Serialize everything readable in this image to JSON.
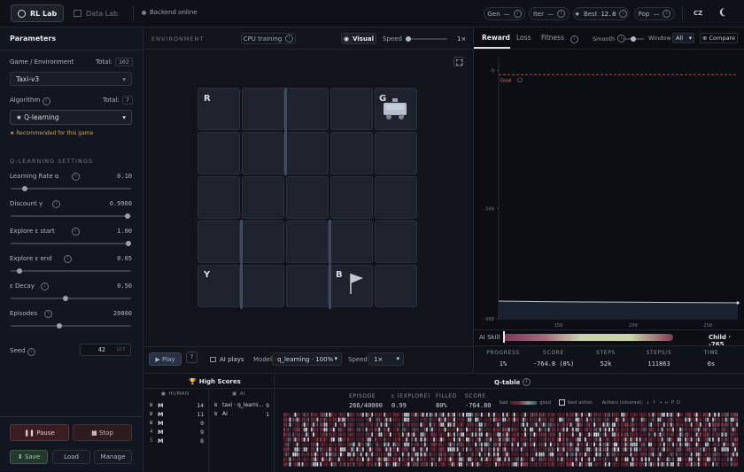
{
  "topbar": {
    "tabs": [
      {
        "label": "RL Lab"
      },
      {
        "label": "Data Lab"
      }
    ],
    "status": "Backend online",
    "stats": [
      {
        "label": "Gen",
        "value": "—"
      },
      {
        "label": "Iter",
        "value": "—"
      },
      {
        "label": "Best",
        "value": "12.8"
      },
      {
        "label": "Pop",
        "value": "—"
      }
    ],
    "lang": "CZ"
  },
  "sidebar": {
    "title": "Parameters",
    "env": {
      "label": "Game / Environment",
      "total_label": "Total:",
      "total": "102",
      "value": "Taxi-v3"
    },
    "algo": {
      "label": "Algorithm",
      "total_label": "Total:",
      "total": "7",
      "value": "★ Q-learning",
      "note": "★ Recommended for this game"
    },
    "section": "Q-LEARNING SETTINGS",
    "params": [
      {
        "label": "Learning Rate α",
        "value": "0.10",
        "fraction": 0.1
      },
      {
        "label": "Discount γ",
        "value": "0.9900",
        "fraction": 0.99
      },
      {
        "label": "Explore ε start",
        "value": "1.00",
        "fraction": 1.0
      },
      {
        "label": "Explore ε end",
        "value": "0.05",
        "fraction": 0.05
      },
      {
        "label": "ε Decay",
        "value": "0.50",
        "fraction": 0.45
      },
      {
        "label": "Episodes",
        "value": "20000",
        "fraction": 0.4
      }
    ],
    "seed": {
      "label": "Seed",
      "value": "42",
      "unit": "int"
    },
    "buttons": {
      "pause": "Pause",
      "stop": "Stop",
      "save": "Save",
      "load": "Load",
      "manage": "Manage"
    }
  },
  "env": {
    "title": "ENVIRONMENT",
    "device": "CPU training",
    "visual": "Visual",
    "speed_label": "Speed",
    "speed_value": "1×",
    "grid": {
      "R": "R",
      "G": "G",
      "Y": "Y",
      "B": "B"
    },
    "controls": {
      "play": "Play",
      "ai_plays": "AI plays",
      "model_label": "Model",
      "model_value": "q_learning · 100%",
      "speed_label": "Speed",
      "speed_value": "1×"
    }
  },
  "chart": {
    "tabs": [
      "Reward",
      "Loss",
      "Fitness"
    ],
    "smooth_label": "Smooth",
    "window_label": "Window",
    "window_value": "All",
    "compare": "Compare",
    "goal_label": "Goal",
    "ai_skill": "AI Skill",
    "skill_result": "Child · -765"
  },
  "chart_data": {
    "type": "line",
    "y_ticks": [
      0,
      -500,
      -900
    ],
    "x_ticks": [
      150,
      200,
      250
    ],
    "xlim": [
      110,
      270
    ],
    "ylim": [
      -900,
      50
    ],
    "goal": -15,
    "series": [
      {
        "x": [
          110,
          140,
          170,
          200,
          230,
          260,
          270
        ],
        "y": [
          -836,
          -838,
          -839,
          -840,
          -841,
          -842,
          -842
        ]
      }
    ]
  },
  "metrics": [
    {
      "label": "PROGRESS",
      "value": "1%"
    },
    {
      "label": "SCORE",
      "value": "-764.8 (0%)"
    },
    {
      "label": "STEPS",
      "value": "52k"
    },
    {
      "label": "STEPS/S",
      "value": "111863"
    },
    {
      "label": "TIME",
      "value": "0s"
    }
  ],
  "scores": {
    "title": "High Scores",
    "human_label": "HUMAN",
    "ai_label": "AI",
    "human": [
      {
        "rank": "",
        "name": "M",
        "score": "14"
      },
      {
        "rank": "",
        "name": "M",
        "score": "11"
      },
      {
        "rank": "",
        "name": "M",
        "score": "9"
      },
      {
        "rank": "4",
        "name": "M",
        "score": "9"
      },
      {
        "rank": "5",
        "name": "M",
        "score": "8"
      }
    ],
    "ai": [
      {
        "name": "taxi · q_learni...",
        "score": "9"
      },
      {
        "name": "AI",
        "score": "1"
      }
    ]
  },
  "qtable": {
    "title": "Q-table",
    "stats": [
      {
        "label": "EPISODE",
        "value": "266/40000"
      },
      {
        "label": "ε (EXPLORE)",
        "value": "0.99"
      },
      {
        "label": "FILLED",
        "value": "80%"
      },
      {
        "label": "SCORE",
        "value": "-764.80"
      }
    ],
    "legend": {
      "bad": "bad",
      "good": "good",
      "best": "best action",
      "actions": "Actions (columns):"
    },
    "actions": [
      "↓",
      "↑",
      "→",
      "←",
      "P",
      "D"
    ]
  }
}
